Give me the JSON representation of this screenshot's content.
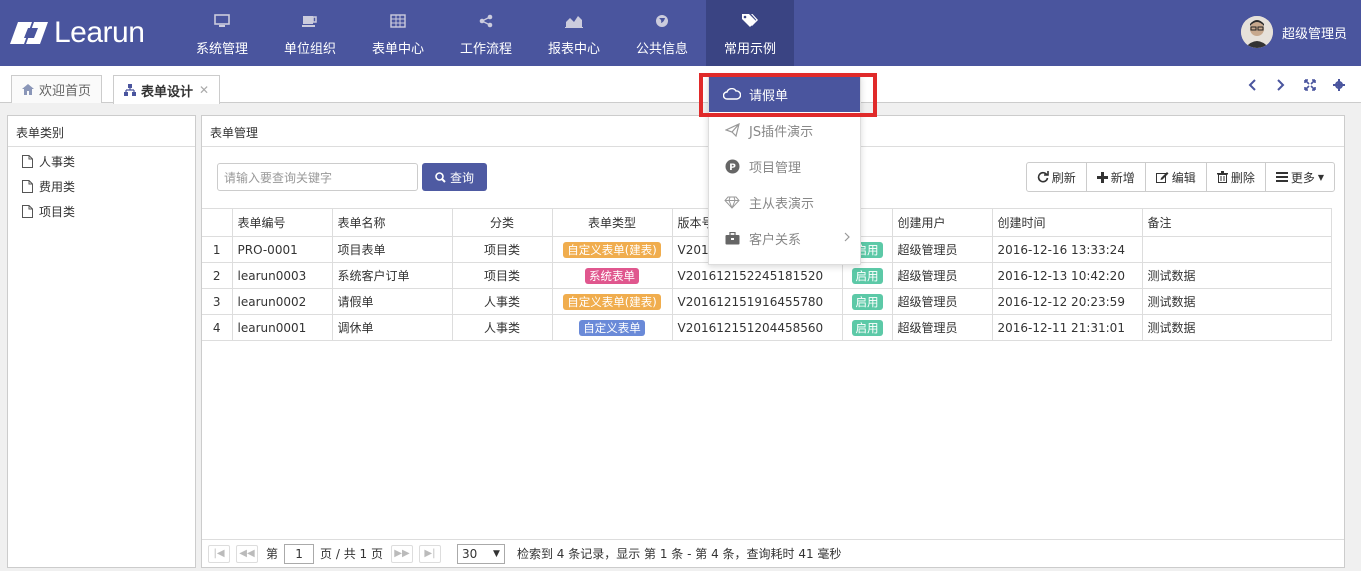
{
  "app": {
    "logo_text": "Learun",
    "user_name": "超级管理员"
  },
  "nav": [
    {
      "label": "系统管理",
      "icon": "monitor-icon"
    },
    {
      "label": "单位组织",
      "icon": "coffee-icon"
    },
    {
      "label": "表单中心",
      "icon": "table-icon"
    },
    {
      "label": "工作流程",
      "icon": "share-icon"
    },
    {
      "label": "报表中心",
      "icon": "area-chart-icon"
    },
    {
      "label": "公共信息",
      "icon": "globe-icon"
    },
    {
      "label": "常用示例",
      "icon": "tags-icon",
      "active": true
    }
  ],
  "tabs": [
    {
      "label": "欢迎首页",
      "icon": "home-icon"
    },
    {
      "label": "表单设计",
      "icon": "sitemap-icon",
      "active": true
    }
  ],
  "left_panel": {
    "title": "表单类别",
    "items": [
      "人事类",
      "费用类",
      "项目类"
    ]
  },
  "main_panel": {
    "title": "表单管理",
    "search_placeholder": "请输入要查询关键字",
    "search_button": "查询",
    "toolbar": {
      "refresh": "刷新",
      "add": "新增",
      "edit": "编辑",
      "delete": "删除",
      "more": "更多"
    }
  },
  "table": {
    "columns": [
      "",
      "表单编号",
      "表单名称",
      "分类",
      "表单类型",
      "版本号",
      "状态",
      "创建用户",
      "创建时间",
      "备注"
    ],
    "rows": [
      {
        "idx": "1",
        "code": "PRO-0001",
        "name": "项目表单",
        "category": "项目类",
        "type": "自定义表单(建表)",
        "type_color": "orange",
        "version": "V201612152245181520",
        "status": "启用",
        "user": "超级管理员",
        "time": "2016-12-16 13:33:24",
        "remark": ""
      },
      {
        "idx": "2",
        "code": "learun0003",
        "name": "系统客户订单",
        "category": "项目类",
        "type": "系统表单",
        "type_color": "pink",
        "version": "V201612152245181520",
        "status": "启用",
        "user": "超级管理员",
        "time": "2016-12-13 10:42:20",
        "remark": "测试数据"
      },
      {
        "idx": "3",
        "code": "learun0002",
        "name": "请假单",
        "category": "人事类",
        "type": "自定义表单(建表)",
        "type_color": "orange",
        "version": "V201612151916455780",
        "status": "启用",
        "user": "超级管理员",
        "time": "2016-12-12 20:23:59",
        "remark": "测试数据"
      },
      {
        "idx": "4",
        "code": "learun0001",
        "name": "调休单",
        "category": "人事类",
        "type": "自定义表单",
        "type_color": "blue",
        "version": "V201612151204458560",
        "status": "启用",
        "user": "超级管理员",
        "time": "2016-12-11 21:31:01",
        "remark": "测试数据"
      }
    ],
    "visible_header": {
      "version": "版本号",
      "status": "态"
    },
    "row_versions_visible": [
      "V201",
      "V201612152245181520",
      "V201612151916455780",
      "V201612151204458560"
    ]
  },
  "pager": {
    "page_prefix": "第",
    "page": "1",
    "page_suffix": "页 / 共 1 页",
    "page_size": "30",
    "summary": "检索到 4 条记录，显示 第 1 条 - 第 4 条，查询耗时 41 毫秒"
  },
  "dropdown": [
    {
      "label": "请假单",
      "icon": "cloud-icon",
      "active": true
    },
    {
      "label": "JS插件演示",
      "icon": "paper-plane-icon"
    },
    {
      "label": "项目管理",
      "icon": "p-circle-icon"
    },
    {
      "label": "主从表演示",
      "icon": "diamond-icon"
    },
    {
      "label": "客户关系",
      "icon": "briefcase-icon",
      "submenu": true
    }
  ],
  "colors": {
    "nav_bg": "#4a559e",
    "nav_active": "#3a4483",
    "highlight": "#e02a2a"
  }
}
